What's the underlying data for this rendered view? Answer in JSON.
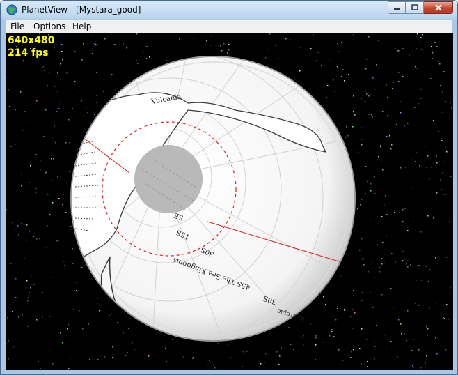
{
  "window": {
    "title": "PlanetView - [Mystara_good]",
    "icons": {
      "app": "globe-icon",
      "minimize": "minimize-icon",
      "maximize": "maximize-icon",
      "close": "close-icon"
    }
  },
  "menu": {
    "items": [
      "File",
      "Options",
      "Help"
    ]
  },
  "overlay": {
    "resolution": "640x480",
    "fps": "214 fps"
  },
  "map": {
    "labels": {
      "region_north": "Vulcania",
      "lat_1": "5E",
      "lat_2": "15S",
      "lat_3": "30S",
      "sea": "45S The Sea Kingdoms",
      "lat_4": "30S",
      "tropic": "S. Tropic"
    }
  },
  "colors": {
    "space": "#000000",
    "globe": "#ffffff",
    "polar_cap": "#b9b9b9",
    "grid": "#d0d0d0",
    "circle_line": "#e02020",
    "overlay_text": "#ffff00"
  }
}
